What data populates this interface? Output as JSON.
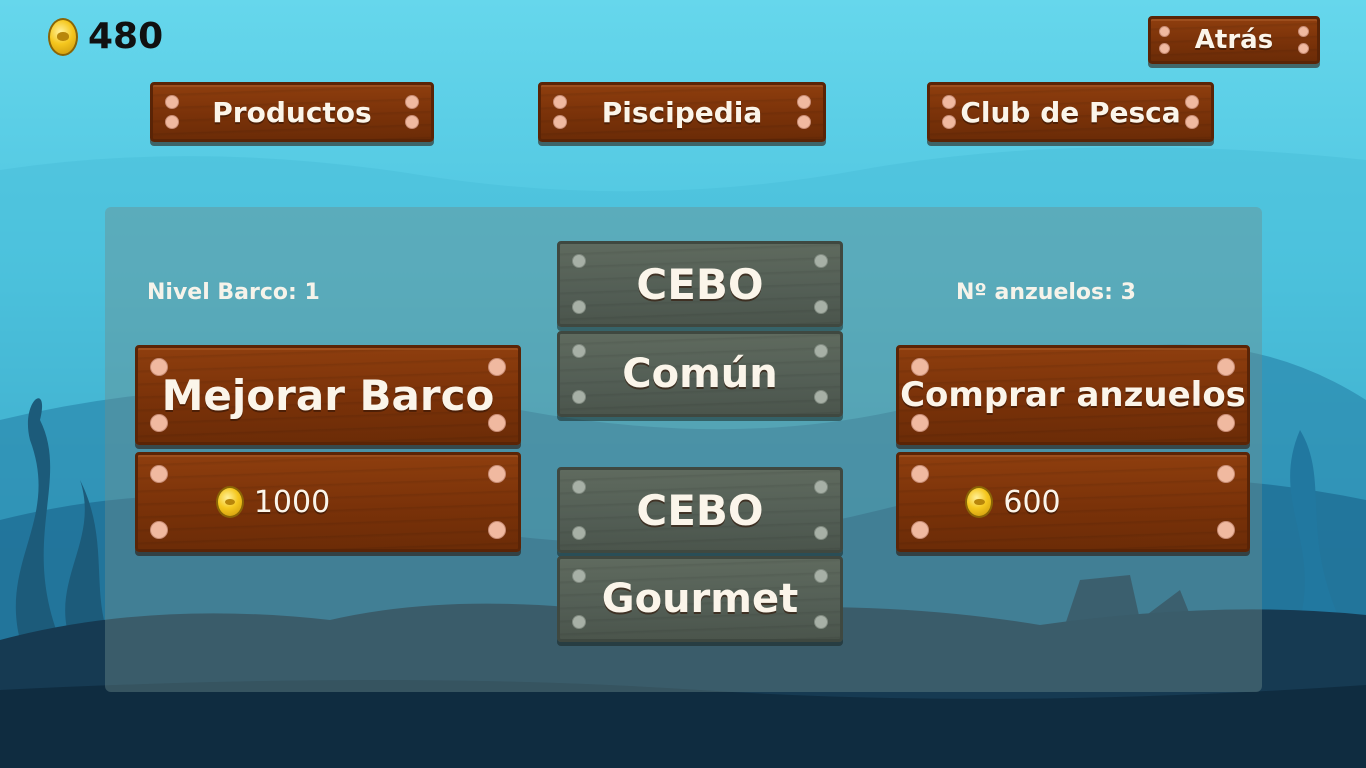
{
  "hud": {
    "coins": "480",
    "coin_icon": "gold-coin-icon"
  },
  "nav": {
    "back_label": "Atrás",
    "tabs": [
      {
        "label": "Productos"
      },
      {
        "label": "Piscipedia"
      },
      {
        "label": "Club de Pesca"
      }
    ]
  },
  "shop": {
    "boat": {
      "level_label": "Nivel Barco: 1",
      "button_label": "Mejorar Barco",
      "price": "1000"
    },
    "bait_common": {
      "line1": "CEBO",
      "line2": "Común"
    },
    "bait_gourmet": {
      "line1": "CEBO",
      "line2": "Gourmet"
    },
    "hooks": {
      "count_label": "Nº anzuelos: 3",
      "button_label": "Comprar anzuelos",
      "price": "600"
    }
  },
  "colors": {
    "sky": "#5fd3e9",
    "wood": "#7a3209",
    "wood_grey": "#535e55",
    "panel": "#6e8c8c",
    "seabed": "#163a52"
  }
}
